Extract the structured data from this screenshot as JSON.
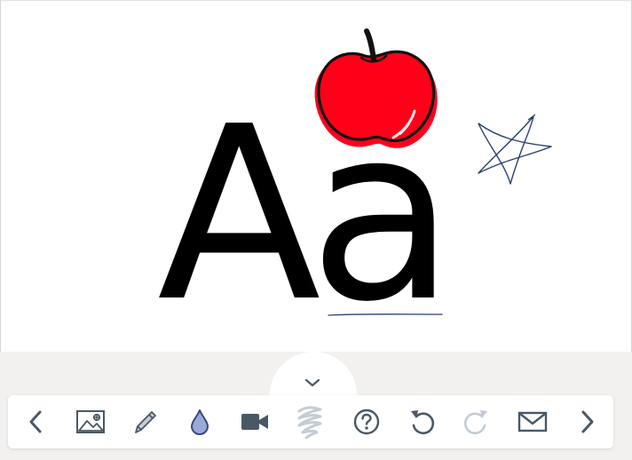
{
  "canvas": {
    "text": "Aa"
  },
  "toolbar": {
    "collapse": "toolbar-collapse",
    "tools": [
      {
        "name": "back",
        "icon": "chevron-left-icon",
        "enabled": true
      },
      {
        "name": "insert-image",
        "icon": "image-add-icon",
        "enabled": true
      },
      {
        "name": "pen",
        "icon": "pencil-icon",
        "enabled": true
      },
      {
        "name": "color",
        "icon": "drop-icon",
        "enabled": true
      },
      {
        "name": "record-video",
        "icon": "video-camera-icon",
        "enabled": true
      },
      {
        "name": "clear",
        "icon": "scribble-eraser-icon",
        "enabled": false
      },
      {
        "name": "help",
        "icon": "help-circle-icon",
        "enabled": true
      },
      {
        "name": "undo",
        "icon": "undo-icon",
        "enabled": true
      },
      {
        "name": "redo",
        "icon": "redo-icon",
        "enabled": false
      },
      {
        "name": "send",
        "icon": "envelope-icon",
        "enabled": true
      },
      {
        "name": "forward",
        "icon": "chevron-right-icon",
        "enabled": true
      }
    ]
  },
  "colors": {
    "icon": "#4a5866",
    "icon_disabled": "#c3ccd4",
    "drop_fill": "#9aa9d9",
    "apple_red": "#ff001f",
    "ink_blue": "#2c3f73",
    "toolbar_bg": "#ffffff",
    "tray_bg": "#f3f1ef"
  }
}
